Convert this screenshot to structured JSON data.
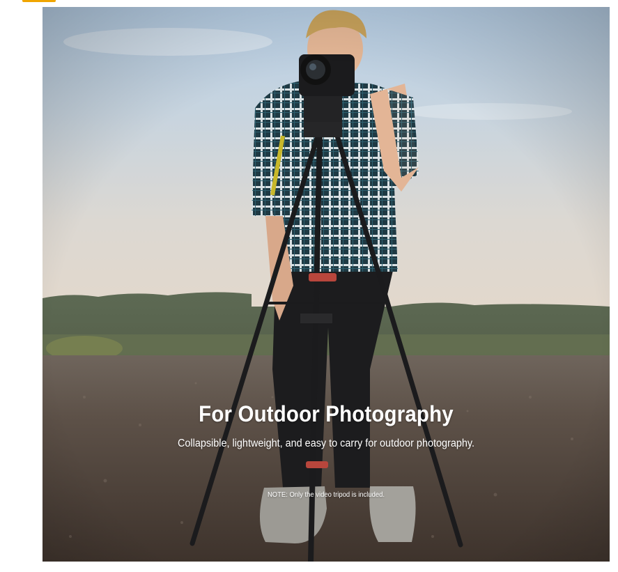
{
  "hero": {
    "title": "For Outdoor Photography",
    "subtitle": "Collapsible, lightweight, and easy to carry for outdoor photography.",
    "note": "NOTE: Only the video tripod is included."
  },
  "colors": {
    "accent": "#f0a500",
    "caption_text": "#ffffff"
  },
  "image": {
    "subject": "photographer-with-video-tripod-in-field"
  }
}
